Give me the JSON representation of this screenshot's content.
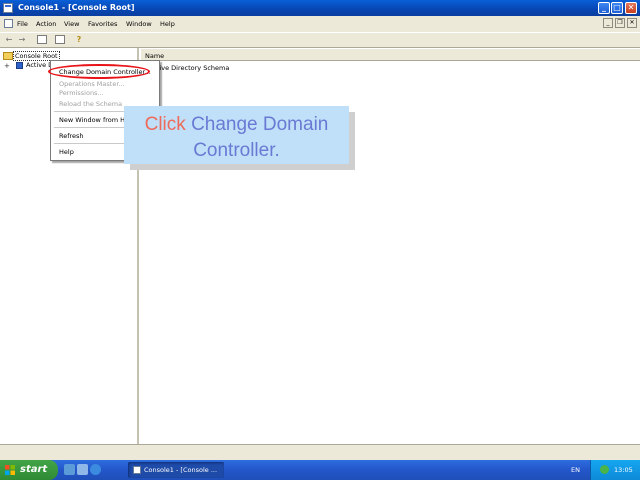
{
  "window": {
    "title": "Console1 - [Console Root]"
  },
  "title_buttons": {
    "minimize": "_",
    "maximize": "□",
    "close": "✕"
  },
  "mdi_buttons": {
    "minimize": "_",
    "restore": "❐",
    "close": "✕"
  },
  "menu": {
    "items": [
      "File",
      "Action",
      "View",
      "Favorites",
      "Window",
      "Help"
    ]
  },
  "toolbar": {
    "icons": [
      "back-arrow-icon",
      "forward-arrow-icon",
      "show-hide-tree-icon",
      "export-list-icon",
      "help-icon"
    ]
  },
  "tree": {
    "root_label": "Console Root",
    "child_label": "Active Directory Schema",
    "expand_glyph": "+"
  },
  "list": {
    "column_header": "Name",
    "rows": [
      "Active Directory Schema"
    ]
  },
  "context_menu": {
    "items": [
      {
        "label": "Change Domain Controller...",
        "enabled": true
      },
      {
        "label": "Operations Master...",
        "enabled": false
      },
      {
        "label": "Permissions...",
        "enabled": false
      },
      {
        "label": "Reload the Schema",
        "enabled": false
      },
      {
        "label": "New Window from Here",
        "enabled": true
      },
      {
        "label": "Refresh",
        "enabled": true
      },
      {
        "label": "Help",
        "enabled": true
      }
    ]
  },
  "callout": {
    "action": "Click",
    "target_line1": "Change Domain",
    "target_line2": "Controller."
  },
  "taskbar": {
    "start_label": "start",
    "task_label": "Console1 - [Console ...",
    "language": "EN",
    "clock": "13:05"
  },
  "colors": {
    "highlight_ring": "#e8141a",
    "callout_bg": "#bfe0f8",
    "callout_action": "#ee6a5a",
    "callout_target": "#6a79d4",
    "titlebar": "#0747b5",
    "taskbar": "#2456c9",
    "start_button": "#3a9a3e"
  }
}
